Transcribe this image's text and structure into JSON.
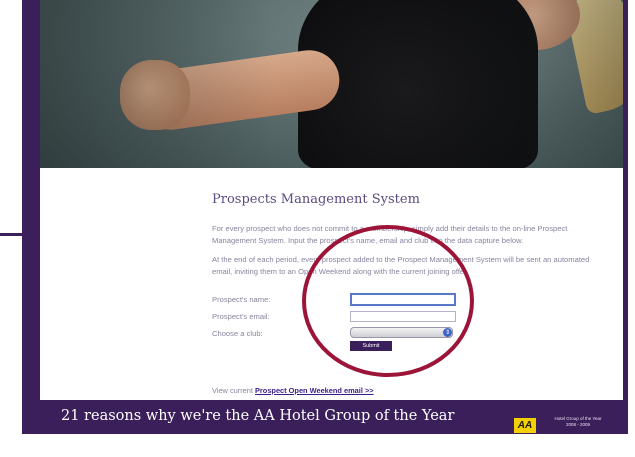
{
  "page": {
    "title": "Prospects Management System",
    "paragraphs": [
      "For every prospect who does not commit to a membership, simply add their details to the on-line Prospect Management System. Input the prospect's name, email and club into the data capture below.",
      "At the end of each period, every prospect added to the Prospect Management System will be sent an automated email, inviting them to an Open Weekend along with the current joining offer."
    ]
  },
  "form": {
    "name_label": "Prospect's name:",
    "email_label": "Prospect's email:",
    "club_label": "Choose a club:",
    "name_value": "",
    "email_value": "",
    "club_value": "",
    "submit_label": "Submit"
  },
  "footer_link": {
    "prefix": "View current ",
    "link_text": "Prospect Open Weekend email >>"
  },
  "banner": {
    "text": "21 reasons why we're the AA Hotel Group of the Year",
    "logo_text": "AA",
    "award_line1": "Hotel Group of the Year",
    "award_line2": "2008 - 2009"
  },
  "colors": {
    "frame": "#3b1f5a",
    "highlight_circle": "#9c1438",
    "aa_yellow": "#f5d000"
  },
  "icons": {
    "select_arrow": "select-arrow-icon",
    "logo": "aa-logo-icon"
  }
}
